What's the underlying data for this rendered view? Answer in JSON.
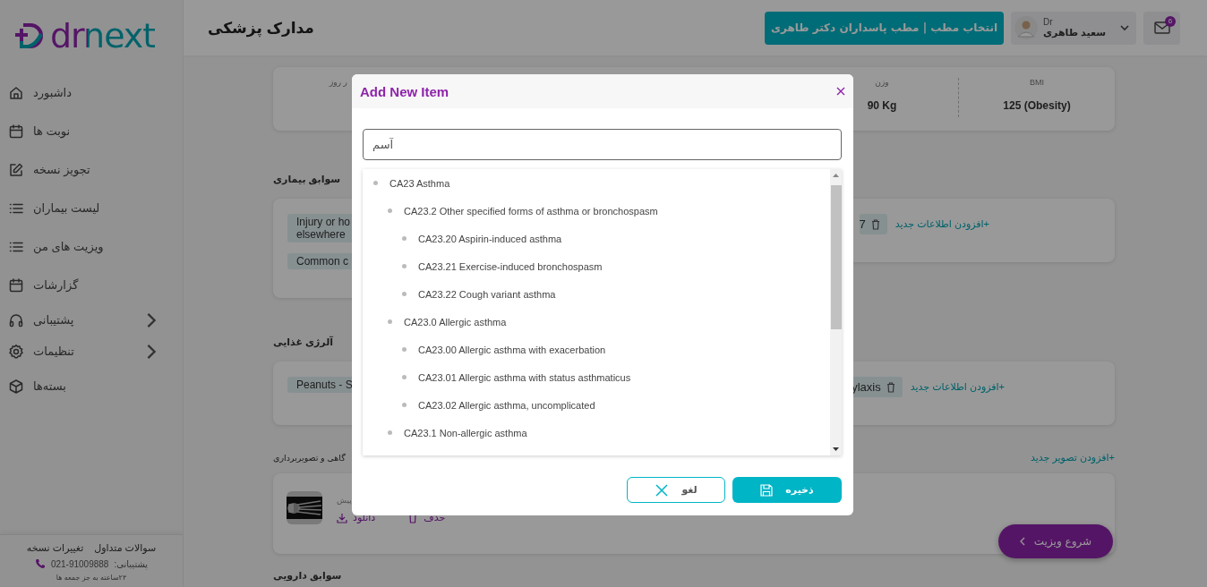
{
  "sidebar": {
    "logo": "drnext",
    "items": [
      {
        "label": "داشبورد",
        "submenu": false
      },
      {
        "label": "نوبت ها",
        "submenu": false
      },
      {
        "label": "تجویز نسخه",
        "submenu": false
      },
      {
        "label": "لیست بیماران",
        "submenu": false
      },
      {
        "label": "ویزیت های من",
        "submenu": false
      },
      {
        "label": "گزارشات",
        "submenu": false
      },
      {
        "label": "پشتیبانی",
        "submenu": true
      },
      {
        "label": "تنظیمات",
        "submenu": true
      },
      {
        "label": "بسته‌ها",
        "submenu": false
      }
    ],
    "footer": {
      "links": [
        "سوالات متداول",
        "تغییرات نسخه"
      ],
      "support_label": "پشتیبانی:",
      "support_phone": "021-91009888",
      "hours": "۲۴ساعته به جز جمعه ها"
    }
  },
  "header": {
    "title": "مدارک پزشکی",
    "clinic_button": "انتخاب مطب | مطب پاسداران دکتر طاهری",
    "user": {
      "prefix": "Dr",
      "name": "سعید طاهری"
    },
    "mail_badge": "6"
  },
  "vitals": [
    {
      "label": "BMI",
      "value": "125 (Obesity)"
    },
    {
      "label": "وزن",
      "value": "90 Kg"
    },
    {
      "label": "ر روز"
    }
  ],
  "sections": [
    {
      "kind": "tags",
      "title": "سوابق بیماری",
      "tags": [
        {
          "lines": [
            "Injury or ho",
            "elsewhere"
          ]
        },
        {
          "lines": [
            "Common c"
          ]
        }
      ],
      "end_tag": "7",
      "add_link": "+افزودن اطلاعات جدید"
    },
    {
      "kind": "tags",
      "title": "آلرژی غذایی",
      "tags": [
        {
          "lines": [
            "Peanuts - S"
          ]
        }
      ],
      "end_tag": "ylaxis",
      "add_link": "+افزودن اطلاعات جدید"
    },
    {
      "kind": "files",
      "title": "گاهی و تصویربرداری",
      "add_link": "+افزودن تصویر جدید",
      "files": [
        {
          "kind": "picture",
          "caption": "پیش",
          "download": "دانلود",
          "delete": "حذف"
        }
      ]
    },
    {
      "kind": "heading",
      "title": "سوابق دارویی"
    }
  ],
  "start_visit_button": "شروع ویزیت",
  "modal": {
    "title": "Add New Item",
    "search_value": "آسم",
    "tree": [
      {
        "label": "CA23 Asthma",
        "children": [
          {
            "label": "CA23.2 Other specified forms of asthma or bronchospasm",
            "children": [
              {
                "label": "CA23.20 Aspirin-induced asthma"
              },
              {
                "label": "CA23.21 Exercise-induced bronchospasm"
              },
              {
                "label": "CA23.22 Cough variant asthma"
              }
            ]
          },
          {
            "label": "CA23.0 Allergic asthma",
            "children": [
              {
                "label": "CA23.00 Allergic asthma with exacerbation"
              },
              {
                "label": "CA23.01 Allergic asthma with status asthmaticus"
              },
              {
                "label": "CA23.02 Allergic asthma, uncomplicated"
              }
            ]
          },
          {
            "label": "CA23.1 Non-allergic asthma"
          }
        ]
      }
    ],
    "cancel_button": "لغو",
    "save_button": "ذخیره"
  }
}
